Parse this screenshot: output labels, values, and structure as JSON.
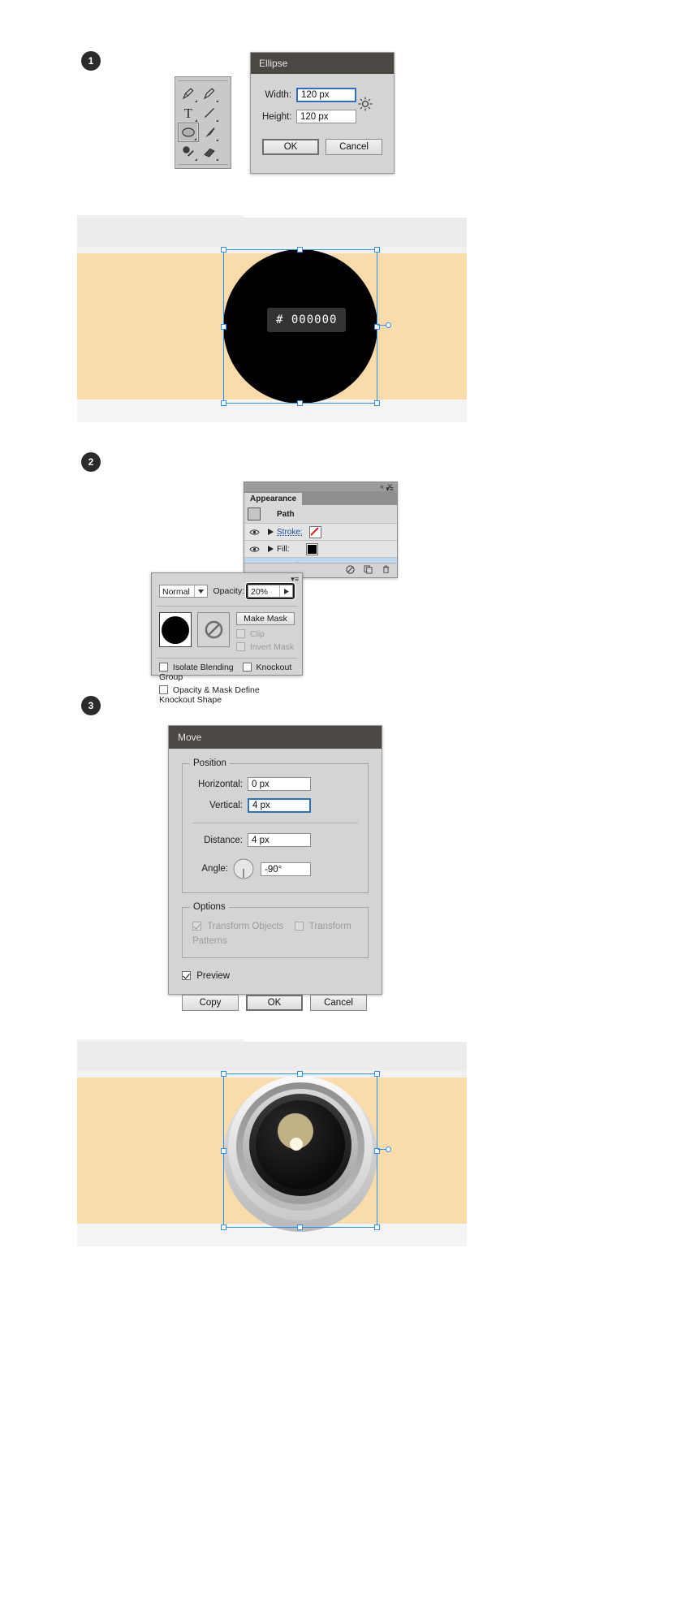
{
  "steps": [
    {
      "number": "1"
    },
    {
      "number": "2"
    },
    {
      "number": "3"
    }
  ],
  "toolbar": {
    "tools": [
      {
        "name": "pen-tool"
      },
      {
        "name": "add-anchor-point-tool"
      },
      {
        "name": "type-tool",
        "glyph": "T"
      },
      {
        "name": "line-segment-tool"
      },
      {
        "name": "ellipse-tool",
        "selected": true
      },
      {
        "name": "paintbrush-tool"
      },
      {
        "name": "blob-brush-tool"
      },
      {
        "name": "eraser-tool"
      }
    ]
  },
  "ellipse_dialog": {
    "title": "Ellipse",
    "width_label": "Width:",
    "width_value": "120 px",
    "height_label": "Height:",
    "height_value": "120 px",
    "constrain_icon": "link-proportions-icon",
    "ok_label": "OK",
    "cancel_label": "Cancel"
  },
  "artboard_one": {
    "hex_label": "# 000000",
    "shape_fill": "#000000",
    "band_color": "#fadcab",
    "paper_color": "#f2f2f2",
    "selection_color": "#2e8ef7"
  },
  "appearance_panel": {
    "tab_label": "Appearance",
    "close_icon": "close-icon",
    "collapse_icon": "double-chevron-icon",
    "menu_icon": "panel-menu-icon",
    "rows": [
      {
        "label": "Path",
        "type": "header"
      },
      {
        "label": "Stroke:",
        "type": "attribute",
        "swatch": "none-red-slash"
      },
      {
        "label": "Fill:",
        "type": "attribute",
        "swatch": "#000000"
      },
      {
        "label": "Opacity:",
        "type": "opacity",
        "value": "20%",
        "selected": true
      }
    ],
    "footer_icons": [
      "no-effect-icon",
      "duplicate-icon",
      "trash-icon"
    ]
  },
  "transparency_panel": {
    "blend_mode": "Normal",
    "opacity_label": "Opacity:",
    "opacity_value": "20%",
    "make_mask_label": "Make Mask",
    "clip_label": "Clip",
    "invert_mask_label": "Invert Mask",
    "isolate_blending_label": "Isolate Blending",
    "knockout_group_label": "Knockout Group",
    "knockout_shape_label": "Opacity & Mask Define Knockout Shape",
    "thumb_icon": "black-circle-thumbnail",
    "mask_icon": "no-mask-icon",
    "menu_icon": "panel-menu-icon"
  },
  "move_dialog": {
    "title": "Move",
    "position_group": "Position",
    "horizontal_label": "Horizontal:",
    "horizontal_value": "0 px",
    "vertical_label": "Vertical:",
    "vertical_value": "4 px",
    "distance_label": "Distance:",
    "distance_value": "4 px",
    "angle_label": "Angle:",
    "angle_value": "-90°",
    "angle_dial_icon": "angle-dial-icon",
    "options_group": "Options",
    "transform_objects_label": "Transform Objects",
    "transform_patterns_label": "Transform Patterns",
    "preview_label": "Preview",
    "copy_label": "Copy",
    "ok_label": "OK",
    "cancel_label": "Cancel"
  },
  "artboard_two": {
    "band_color": "#fadcab",
    "paper_color": "#f2f2f2",
    "selection_color": "#2e8ef7",
    "lens_outer": "#cfcfcf",
    "lens_ring": "#9e9e9e",
    "lens_barrel": "#4a4a4a",
    "lens_glass": "#141414",
    "lens_flare": "#cdbd8f",
    "lens_highlight": "#ffffff"
  }
}
